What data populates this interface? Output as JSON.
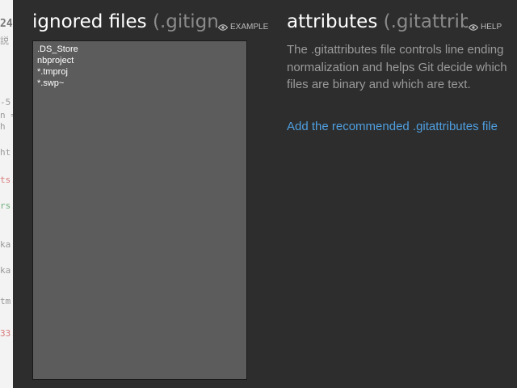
{
  "background_editor": {
    "lines": [
      {
        "text": "24",
        "style": "bold"
      },
      {
        "text": "説",
        "style": "normal"
      },
      {
        "text": "-5",
        "style": "normal"
      },
      {
        "text": "n =",
        "style": "normal"
      },
      {
        "text": "h",
        "style": "normal"
      },
      {
        "text": "ht",
        "style": "normal"
      },
      {
        "text": "ts.",
        "style": "red"
      },
      {
        "text": "rs.",
        "style": "green"
      },
      {
        "text": "ka",
        "style": "normal"
      },
      {
        "text": "ka",
        "style": "normal"
      },
      {
        "text": "tm",
        "style": "normal"
      },
      {
        "text": "33.",
        "style": "red"
      }
    ]
  },
  "ignored_files": {
    "title": "ignored files",
    "subtitle": "(.gitignore)",
    "help_label": "EXAMPLES",
    "help_icon": "eye-icon",
    "entries": [
      ".DS_Store",
      "nbproject",
      "*.tmproj",
      "*.swp~"
    ]
  },
  "attributes": {
    "title": "attributes",
    "subtitle": "(.gitattributes)",
    "help_label": "HELP",
    "help_icon": "eye-icon",
    "description": "The .gitattributes file controls line ending normalization and helps Git decide which files are binary and which are text.",
    "recommend_link": "Add the recommended .gitattributes file"
  },
  "colors": {
    "panel_bg": "#2d2d2d",
    "editor_bg": "#5c5c5c",
    "link": "#4f9fe0",
    "muted_text": "#8a8a8a"
  }
}
